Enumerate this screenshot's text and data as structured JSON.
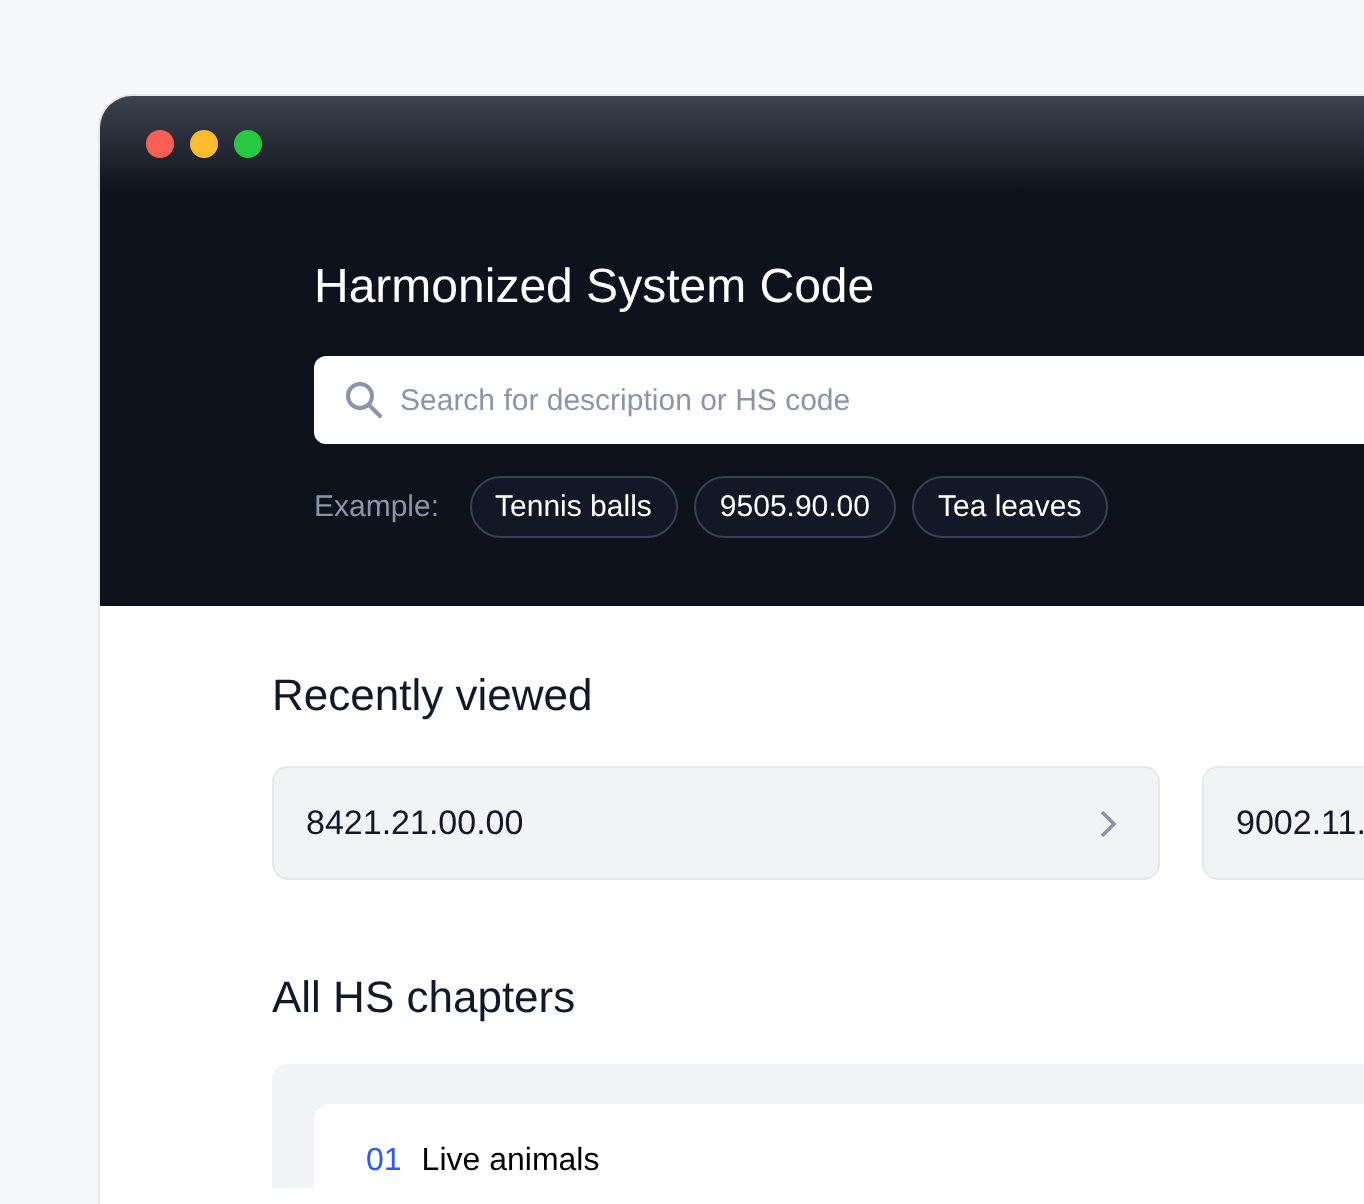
{
  "window": {
    "title_bar": {
      "buttons": [
        {
          "kind": "close"
        },
        {
          "kind": "minimize"
        },
        {
          "kind": "maximize"
        }
      ]
    }
  },
  "header": {
    "title": "Harmonized System Code",
    "search": {
      "placeholder": "Search for description or HS code"
    },
    "examples_label": "Example:",
    "examples": [
      "Tennis balls",
      "9505.90.00",
      "Tea leaves"
    ]
  },
  "recently_viewed": {
    "heading": "Recently viewed",
    "items": [
      {
        "code": "8421.21.00.00"
      },
      {
        "code": "9002.11."
      }
    ]
  },
  "chapters": {
    "heading": "All HS chapters",
    "items": [
      {
        "number": "01",
        "name": "Live animals"
      }
    ]
  }
}
